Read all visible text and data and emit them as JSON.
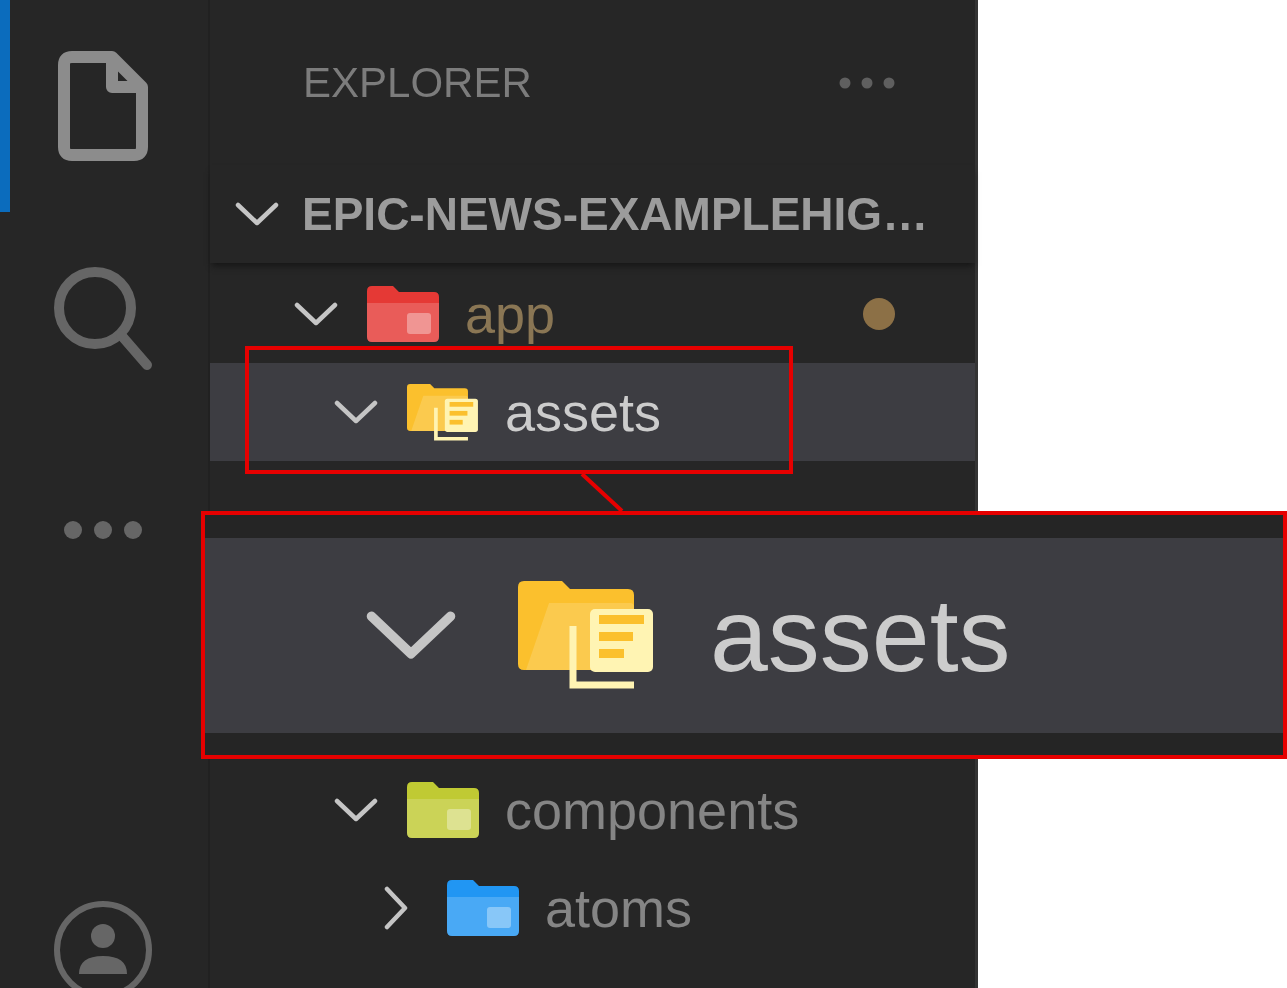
{
  "activity_bar": {
    "items": [
      {
        "kind": "files",
        "selected": true
      },
      {
        "kind": "search",
        "selected": false
      },
      {
        "kind": "more",
        "selected": false
      },
      {
        "kind": "account",
        "selected": false
      }
    ]
  },
  "explorer": {
    "title": "EXPLORER",
    "root": {
      "label": "EPIC-NEWS-EXAMPLEHIG…",
      "expanded": true,
      "children": [
        {
          "label": "app",
          "kind": "folder",
          "color": "#e53935",
          "expanded": true,
          "selected": false,
          "modified": true,
          "children": [
            {
              "label": "assets",
              "kind": "documents",
              "color": "#fbc02d",
              "expanded": true,
              "selected": true,
              "modified": false
            },
            {
              "label": "components",
              "kind": "folder",
              "color": "#c0ca33",
              "expanded": true,
              "selected": false,
              "modified": false,
              "children": [
                {
                  "label": "atoms",
                  "kind": "folder",
                  "color": "#2196f3",
                  "expanded": false,
                  "selected": false,
                  "modified": false
                }
              ]
            }
          ]
        }
      ]
    }
  },
  "zoom_callout": {
    "label": "assets",
    "kind": "documents",
    "color": "#fbc02d",
    "expanded": true
  }
}
